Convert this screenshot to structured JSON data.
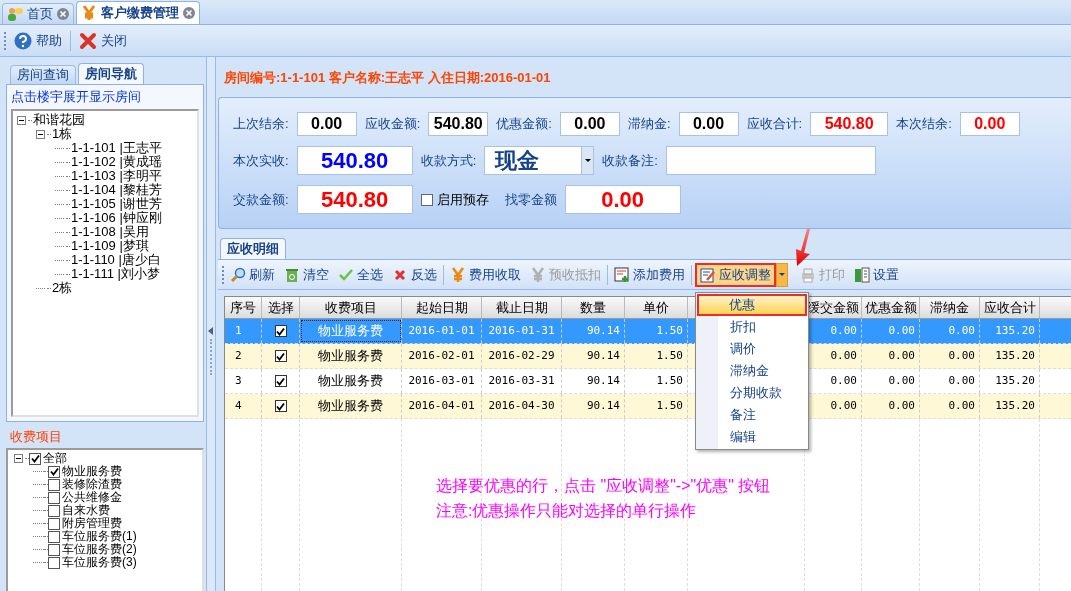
{
  "tabs": [
    {
      "label": "首页",
      "selected": false
    },
    {
      "label": "客户缴费管理",
      "selected": true
    }
  ],
  "toolbar": [
    {
      "label": "帮助"
    },
    {
      "label": "关闭"
    }
  ],
  "left_panel": {
    "tabs": [
      {
        "label": "房间查询",
        "selected": false
      },
      {
        "label": "房间导航",
        "selected": true
      }
    ],
    "hint": "点击楼宇展开显示房间",
    "tree": [
      {
        "label": "和谐花园",
        "expanded": true,
        "children": [
          {
            "label": "1栋",
            "expanded": true,
            "children": [
              {
                "label": "1-1-101 |王志平"
              },
              {
                "label": "1-1-102 |黄成瑶"
              },
              {
                "label": "1-1-103 |李明平"
              },
              {
                "label": "1-1-104 |黎桂芳"
              },
              {
                "label": "1-1-105 |谢世芳"
              },
              {
                "label": "1-1-106 |钟应刚"
              },
              {
                "label": "1-1-108 |吴用"
              },
              {
                "label": "1-1-109 |梦琪"
              },
              {
                "label": "1-1-110 |唐少白"
              },
              {
                "label": "1-1-111 |刘小梦"
              }
            ]
          },
          {
            "label": "2栋"
          }
        ]
      }
    ]
  },
  "fee_items": {
    "title": "收费项目",
    "tree": [
      {
        "label": "全部",
        "checked": true,
        "expanded": true,
        "children": [
          {
            "label": "物业服务费",
            "checked": true
          },
          {
            "label": "装修除渣费",
            "checked": false
          },
          {
            "label": "公共维修金",
            "checked": false
          },
          {
            "label": "自来水费",
            "checked": false
          },
          {
            "label": "附房管理费",
            "checked": false
          },
          {
            "label": "车位服务费(1)",
            "checked": false
          },
          {
            "label": "车位服务费(2)",
            "checked": false
          },
          {
            "label": "车位服务费(3)",
            "checked": false
          }
        ]
      }
    ]
  },
  "header": "房间编号:1-1-101 客户名称:王志平 入住日期:2016-01-01",
  "form": {
    "rows": [
      [
        {
          "kind": "small",
          "label": "上次结余:",
          "value": "0.00",
          "color": "#000000"
        },
        {
          "kind": "small",
          "label": "应收金额:",
          "value": "540.80",
          "color": "#000000"
        },
        {
          "kind": "small",
          "label": "优惠金额:",
          "value": "0.00",
          "color": "#000000"
        },
        {
          "kind": "small",
          "label": "滞纳金:",
          "value": "0.00",
          "color": "#000000"
        },
        {
          "kind": "medium",
          "label": "应收合计:",
          "value": "540.80",
          "color": "#ff0000"
        },
        {
          "kind": "small",
          "label": "本次结余:",
          "value": "0.00",
          "color": "#ff0000"
        }
      ],
      [
        {
          "kind": "large",
          "label": "本次实收:",
          "value": "540.80",
          "color": "#0000ff"
        },
        {
          "kind": "select",
          "label": "收款方式:",
          "value": "现金"
        },
        {
          "kind": "remark",
          "label": "收款备注:"
        }
      ],
      [
        {
          "kind": "large",
          "label": "交款金额:",
          "value": "540.80",
          "color": "#ff0000"
        },
        {
          "kind": "checkbox",
          "label": "启用预存",
          "checked": false
        },
        {
          "kind": "large",
          "label": "找零金额",
          "value": "0.00",
          "color": "#ff0000"
        }
      ]
    ]
  },
  "detail": {
    "tab": "应收明细",
    "toolbar": [
      {
        "label": "刷新",
        "disabled": false
      },
      {
        "label": "清空",
        "disabled": false
      },
      {
        "label": "全选",
        "disabled": false
      },
      {
        "label": "反选",
        "disabled": false
      },
      {
        "label": "费用收取",
        "disabled": false
      },
      {
        "label": "预收抵扣",
        "disabled": true
      },
      {
        "label": "添加费用",
        "disabled": false
      },
      {
        "label": "应收调整",
        "disabled": false,
        "open": true
      },
      {
        "label": "打印",
        "disabled": true
      },
      {
        "label": "设置",
        "disabled": false
      }
    ],
    "columns": [
      "序号",
      "选择",
      "收费项目",
      "起始日期",
      "截止日期",
      "数量",
      "单价",
      "缓交金额",
      "优惠金额",
      "滞纳金",
      "应收合计"
    ],
    "rows": [
      {
        "selected": true,
        "checked": true,
        "cells": [
          "1",
          "",
          "物业服务费",
          "2016-01-01",
          "2016-01-31",
          "90.14",
          "1.50",
          "0.00",
          "0.00",
          "0.00",
          "135.20"
        ]
      },
      {
        "selected": false,
        "checked": true,
        "cells": [
          "2",
          "",
          "物业服务费",
          "2016-02-01",
          "2016-02-29",
          "90.14",
          "1.50",
          "0.00",
          "0.00",
          "0.00",
          "135.20"
        ]
      },
      {
        "selected": false,
        "checked": true,
        "cells": [
          "3",
          "",
          "物业服务费",
          "2016-03-01",
          "2016-03-31",
          "90.14",
          "1.50",
          "0.00",
          "0.00",
          "0.00",
          "135.20"
        ]
      },
      {
        "selected": false,
        "checked": true,
        "cells": [
          "4",
          "",
          "物业服务费",
          "2016-04-01",
          "2016-04-30",
          "90.14",
          "1.50",
          "0.00",
          "0.00",
          "0.00",
          "135.20"
        ]
      }
    ],
    "menu": [
      {
        "label": "优惠",
        "selected": true
      },
      {
        "label": "折扣",
        "selected": false
      },
      {
        "label": "调价",
        "selected": false
      },
      {
        "label": "滞纳金",
        "selected": false
      },
      {
        "label": "分期收款",
        "selected": false
      },
      {
        "label": "备注",
        "selected": false
      },
      {
        "label": "编辑",
        "selected": false
      }
    ]
  },
  "annotation": [
    "选择要优惠的行，点击 \"应收调整\"->\"优惠\" 按钮",
    "注意:优惠操作只能对选择的单行操作"
  ]
}
